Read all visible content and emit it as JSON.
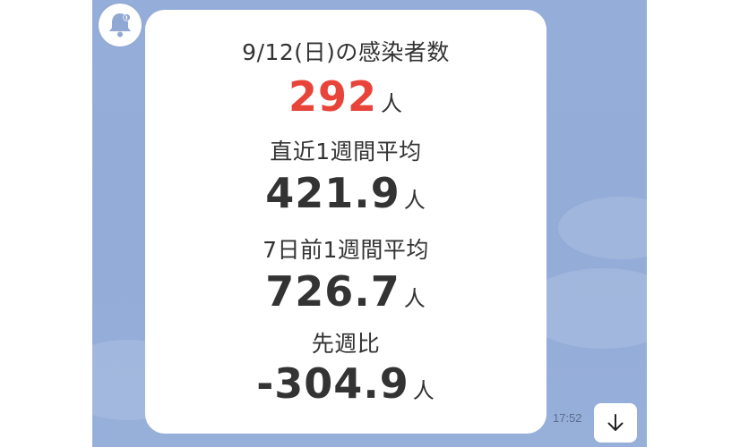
{
  "message": {
    "date_label": "9/12(日)の感染者数",
    "cases_value": "292",
    "cases_unit": "人",
    "avg_label": "直近1週間平均",
    "avg_value": "421.9",
    "avg_unit": "人",
    "prev_avg_label": "7日前1週間平均",
    "prev_avg_value": "726.7",
    "prev_avg_unit": "人",
    "ratio_label": "先週比",
    "ratio_value": "-304.9",
    "ratio_unit": "人",
    "time": "17:52"
  },
  "icons": {
    "avatar": "bell-icon",
    "scroll": "arrow-down-icon"
  },
  "colors": {
    "background": "#95aed9",
    "highlight": "#e8443a",
    "text": "#333333"
  }
}
